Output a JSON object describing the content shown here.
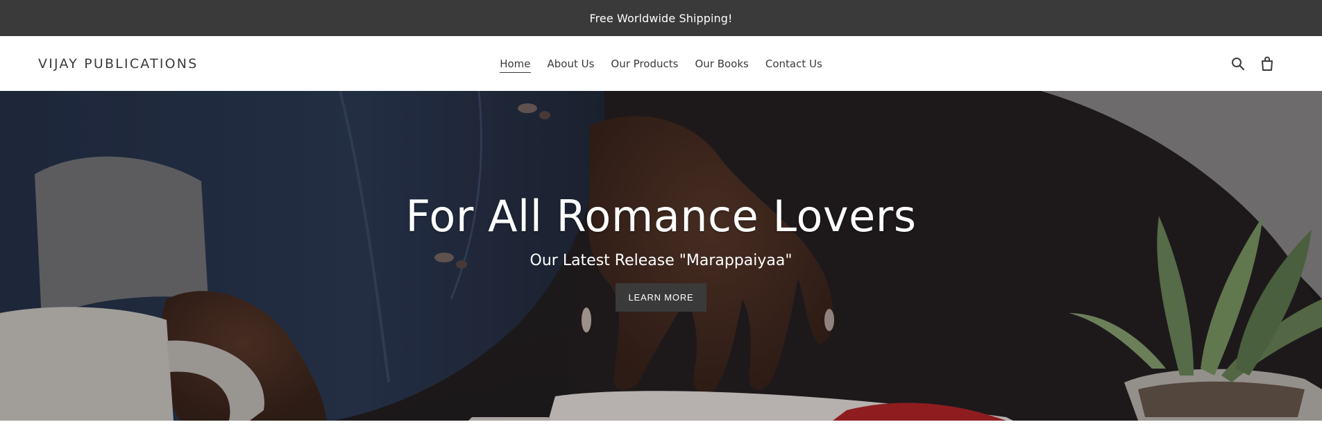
{
  "announcement": {
    "text": "Free Worldwide Shipping!"
  },
  "header": {
    "logo": "VIJAY PUBLICATIONS",
    "nav": [
      {
        "label": "Home",
        "active": true
      },
      {
        "label": "About Us",
        "active": false
      },
      {
        "label": "Our Products",
        "active": false
      },
      {
        "label": "Our Books",
        "active": false
      },
      {
        "label": "Contact Us",
        "active": false
      }
    ],
    "icons": [
      "search-icon",
      "cart-icon"
    ]
  },
  "hero": {
    "title": "For All Romance Lovers",
    "subtitle": "Our Latest Release \"Marappaiyaa\"",
    "button_label": "LEARN MORE"
  },
  "colors": {
    "announcement_bg": "#3a3a3a",
    "text_dark": "#3a3a3a",
    "button_bg": "#3a3a3a",
    "white": "#ffffff"
  }
}
